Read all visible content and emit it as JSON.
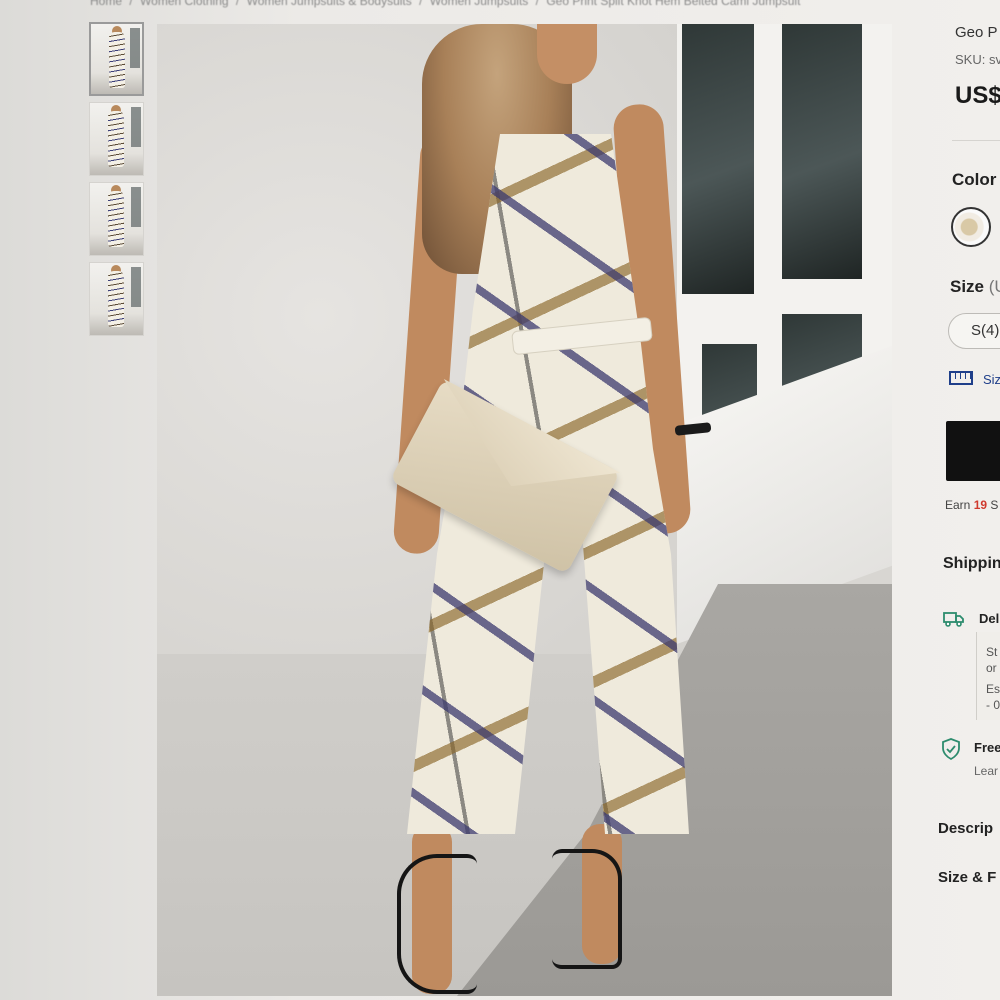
{
  "breadcrumb": [
    "Home",
    "/",
    "Women Clothing",
    "/",
    "Women Jumpsuits & Bodysuits",
    "/",
    "Women Jumpsuits",
    "/",
    "Geo Print Split Knot Hem Belted Cami Jumpsuit"
  ],
  "thumbnails": [
    "thumb-1",
    "thumb-2",
    "thumb-3",
    "thumb-4"
  ],
  "product": {
    "title": "Geo P",
    "sku": "SKU: sv",
    "price": "US$"
  },
  "color": {
    "label": "Color"
  },
  "size": {
    "label": "Size",
    "label_suffix": " (U",
    "selected": "S(4)",
    "guide_label": "Siz"
  },
  "points": {
    "prefix": "Earn ",
    "value": "19",
    "suffix": " S"
  },
  "shipping": {
    "title": "Shippin",
    "delivery_label": "Del",
    "standard_text": "St\nor",
    "estimate_text": "Es\n- 0",
    "free_label": "Free",
    "learn_text": "Lear"
  },
  "sections": {
    "description": "Descrip",
    "size_fit": "Size & F"
  },
  "colors": {
    "accent_blue": "#1f3f8a",
    "accent_green": "#2d8c6e",
    "points_red": "#d03a2e",
    "cart_black": "#111111"
  },
  "icons": {
    "size_guide": "ruler-icon",
    "delivery": "truck-icon",
    "free_return": "shield-check-icon"
  }
}
